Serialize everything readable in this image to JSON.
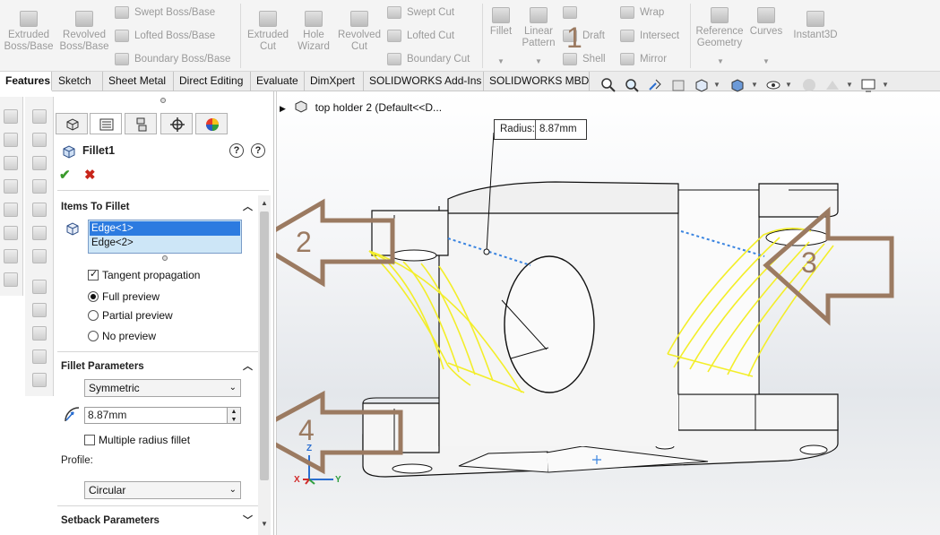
{
  "ribbon": {
    "extruded_boss": "Extruded Boss/Base",
    "revolved_boss": "Revolved Boss/Base",
    "swept_boss": "Swept Boss/Base",
    "lofted_boss": "Lofted Boss/Base",
    "boundary_boss": "Boundary Boss/Base",
    "extruded_cut": "Extruded Cut",
    "hole_wizard": "Hole Wizard",
    "revolved_cut": "Revolved Cut",
    "swept_cut": "Swept Cut",
    "lofted_cut": "Lofted Cut",
    "boundary_cut": "Boundary Cut",
    "fillet": "Fillet",
    "linear_pattern": "Linear Pattern",
    "draft": "Draft",
    "wrap": "Wrap",
    "intersect": "Intersect",
    "mirror": "Mirror",
    "shell": "Shell",
    "reference_geometry": "Reference Geometry",
    "curves": "Curves",
    "instant3d": "Instant3D"
  },
  "tabs": [
    {
      "label": "Features",
      "active": true
    },
    {
      "label": "Sketch"
    },
    {
      "label": "Sheet Metal"
    },
    {
      "label": "Direct Editing"
    },
    {
      "label": "Evaluate"
    },
    {
      "label": "DimXpert"
    },
    {
      "label": "SOLIDWORKS Add-Ins"
    },
    {
      "label": "SOLIDWORKS MBD"
    }
  ],
  "property_manager": {
    "title": "Fillet1",
    "items_to_fillet": {
      "header": "Items To Fillet",
      "edges": [
        "Edge<1>",
        "Edge<2>"
      ],
      "tangent_propagation": "Tangent propagation",
      "previews": [
        "Full preview",
        "Partial preview",
        "No preview"
      ],
      "selected_preview": "Full preview"
    },
    "fillet_parameters": {
      "header": "Fillet Parameters",
      "mode": "Symmetric",
      "radius": "8.87mm",
      "multiple_radius": "Multiple radius fillet",
      "profile_label": "Profile:",
      "profile": "Circular"
    },
    "setback_header": "Setback Parameters"
  },
  "viewport": {
    "tree_label": "top holder 2  (Default<<D...",
    "radius_callout_label": "Radius:",
    "radius_callout_value": "8.87mm",
    "axis_x": "X",
    "axis_y": "Y",
    "axis_z": "Z"
  },
  "annotations": [
    "1",
    "2",
    "3",
    "4"
  ],
  "colors": {
    "arrow": "#9b7a61",
    "preview_yellow": "#f3ee2a",
    "selection_blue": "#2c7be0",
    "ok_green": "#3a9a2c",
    "cancel_red": "#c8251a"
  }
}
